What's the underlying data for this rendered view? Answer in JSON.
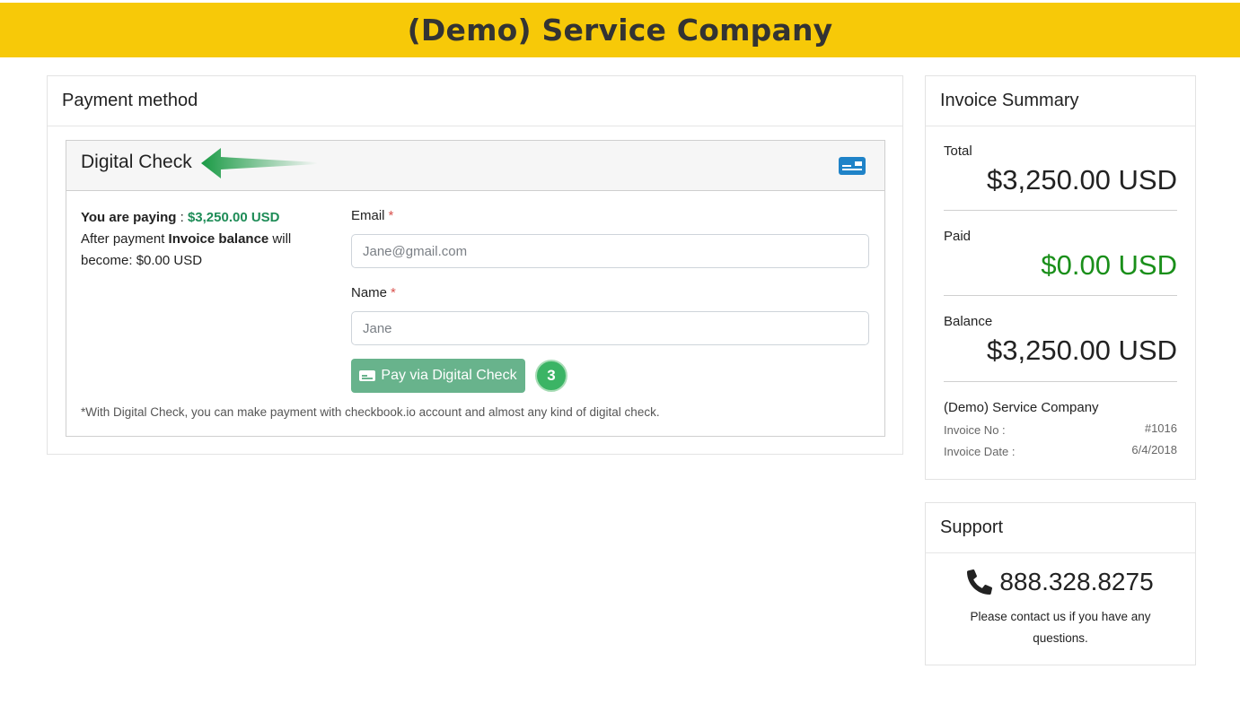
{
  "header": {
    "title": "(Demo) Service Company"
  },
  "payment": {
    "heading": "Payment method",
    "method_title": "Digital Check",
    "paying_label": "You are paying",
    "paying_sep": " : ",
    "paying_amount": "$3,250.00 USD",
    "after_text_1": "After payment ",
    "after_bold": "Invoice balance",
    "after_text_2": " will become: $0.00 USD",
    "email_label": "Email",
    "email_placeholder": "Jane@gmail.com",
    "name_label": "Name",
    "name_placeholder": "Jane",
    "required_mark": "*",
    "pay_button": "Pay via Digital Check",
    "step_badge": "3",
    "footnote": "*With Digital Check, you can make payment with checkbook.io account and almost any kind of digital check."
  },
  "summary": {
    "heading": "Invoice Summary",
    "total_label": "Total",
    "total_value": "$3,250.00 USD",
    "paid_label": "Paid",
    "paid_value": "$0.00 USD",
    "balance_label": "Balance",
    "balance_value": "$3,250.00 USD",
    "company": "(Demo) Service Company",
    "invoice_no_label": "Invoice No :",
    "invoice_no_value": "#1016",
    "invoice_date_label": "Invoice Date :",
    "invoice_date_value": "6/4/2018"
  },
  "support": {
    "heading": "Support",
    "phone": "888.328.8275",
    "text": "Please contact us if you have any questions."
  },
  "colors": {
    "brand_yellow": "#f7c908",
    "accent_green": "#1e8c57",
    "paid_green": "#1a8f1a",
    "button_green": "#68b38c",
    "icon_blue": "#1f83c8"
  },
  "icons": [
    "credit-card-icon",
    "arrow-annotation-icon",
    "phone-icon"
  ]
}
